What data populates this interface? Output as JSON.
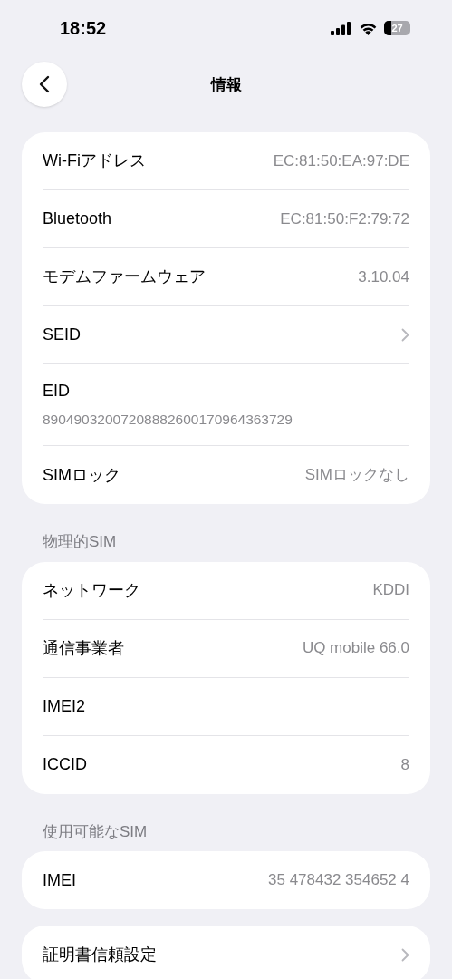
{
  "status_bar": {
    "time": "18:52",
    "battery": "27"
  },
  "nav": {
    "title": "情報"
  },
  "sections": [
    {
      "rows": [
        {
          "kind": "value",
          "label": "Wi-Fiアドレス",
          "value": "EC:81:50:EA:97:DE"
        },
        {
          "kind": "value",
          "label": "Bluetooth",
          "value": "EC:81:50:F2:79:72"
        },
        {
          "kind": "value",
          "label": "モデムファームウェア",
          "value": "3.10.04"
        },
        {
          "kind": "chevron",
          "label": "SEID"
        },
        {
          "kind": "stacked",
          "label": "EID",
          "value": "89049032007208882600170964363729"
        },
        {
          "kind": "value",
          "label": "SIMロック",
          "value": "SIMロックなし"
        }
      ]
    },
    {
      "header": "物理的SIM",
      "rows": [
        {
          "kind": "value",
          "label": "ネットワーク",
          "value": "KDDI"
        },
        {
          "kind": "value",
          "label": "通信事業者",
          "value": "UQ mobile 66.0"
        },
        {
          "kind": "value",
          "label": "IMEI2"
        },
        {
          "kind": "value",
          "label": "ICCID",
          "value": "8"
        }
      ]
    },
    {
      "header": "使用可能なSIM",
      "rows": [
        {
          "kind": "value",
          "label": "IMEI",
          "value": "35 478432 354652 4"
        }
      ]
    },
    {
      "rows": [
        {
          "kind": "chevron",
          "label": "証明書信頼設定"
        }
      ]
    }
  ]
}
